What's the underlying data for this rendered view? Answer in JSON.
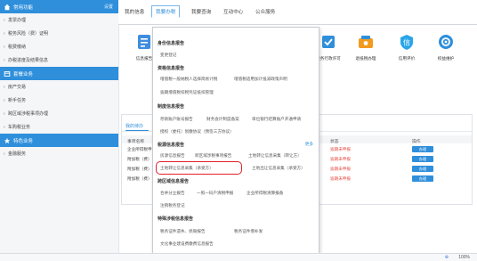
{
  "colors": {
    "primary": "#2f8fdb",
    "alert": "#e54f44",
    "highlight": "#e3202a"
  },
  "sidebar": {
    "sections": [
      {
        "title": "常用功能",
        "icon": "home-icon",
        "action": "设置",
        "items": [
          "发票办理",
          "税务风险（费）证明",
          "税费缴纳",
          "办税进度及结果信息"
        ]
      },
      {
        "title": "套餐业务",
        "icon": "package-icon",
        "items": [
          "房产交易",
          "新手任务",
          "跨区域涉税事项办理",
          "车购税业务"
        ]
      },
      {
        "title": "特色业务",
        "icon": "star-icon",
        "items": [
          "金融服务"
        ]
      }
    ]
  },
  "topnav": {
    "tabs": [
      "我的信息",
      "我要办税",
      "我要查询",
      "互动中心",
      "公众服务"
    ],
    "active": 1
  },
  "services": [
    {
      "label": "信息报告",
      "icon": "report-icon",
      "color": "#3f8ddf"
    },
    {
      "label": "税务行政许可",
      "icon": "license-icon",
      "color": "#2f8fdb"
    },
    {
      "label": "退抵税办理",
      "icon": "refund-icon",
      "color": "#f29a1f"
    },
    {
      "label": "信用评价",
      "icon": "credit-icon",
      "color": "#2aa5e8"
    },
    {
      "label": "权益维护",
      "icon": "rights-icon",
      "color": "#2f8fdb"
    }
  ],
  "workpanel": {
    "tab": "我的待办",
    "headers": [
      "事项名称",
      "状态",
      "操作"
    ],
    "rows": [
      {
        "name": "企业所得税申…",
        "status": "逾期未申报",
        "action": "办理"
      },
      {
        "name": "附加税（费）…",
        "status": "逾期未申报",
        "action": "办理"
      },
      {
        "name": "附加税（费）…",
        "status": "逾期未申报",
        "action": "办理"
      },
      {
        "name": "附加税（费）…",
        "status": "逾期未申报",
        "action": "办理"
      }
    ]
  },
  "dropdown": {
    "sections": [
      {
        "title": "身份信息报告",
        "items": [
          "变更登记"
        ]
      },
      {
        "title": "资格信息报告",
        "items": [
          "增值税一般纳税人选择简易计税",
          "增值税适用加计抵减政策声明",
          "逾期增值税扣税凭证抵扣管理"
        ]
      },
      {
        "title": "制度信息报告",
        "items": [
          "存款账户账号报告",
          "财务会计制度备案",
          "单位银行结算账户开通申请",
          "授权（委托）划缴协议（预签三方协议）"
        ]
      },
      {
        "title": "税源信息报告",
        "more": "更多",
        "items": [
          "房源信息报告",
          "跨区域涉税事项报告",
          "土地转让信息采集（转让方）",
          "土地转让信息采集（承受方）",
          "土地出让信息采集（承受方）"
        ]
      },
      {
        "title": "跨区域信息报告",
        "items": [
          "合并分立报告",
          "一照一码户清税申报",
          "企业所得税清算报备",
          "注销税务登记"
        ]
      },
      {
        "title": "特殊涉税信息报告",
        "items": [
          "税务证件遗失、损毁报告",
          "税务证件增补发",
          "文化事业建设费缴费信息报告"
        ]
      }
    ]
  },
  "statusbar": {
    "zoom": "100%"
  }
}
